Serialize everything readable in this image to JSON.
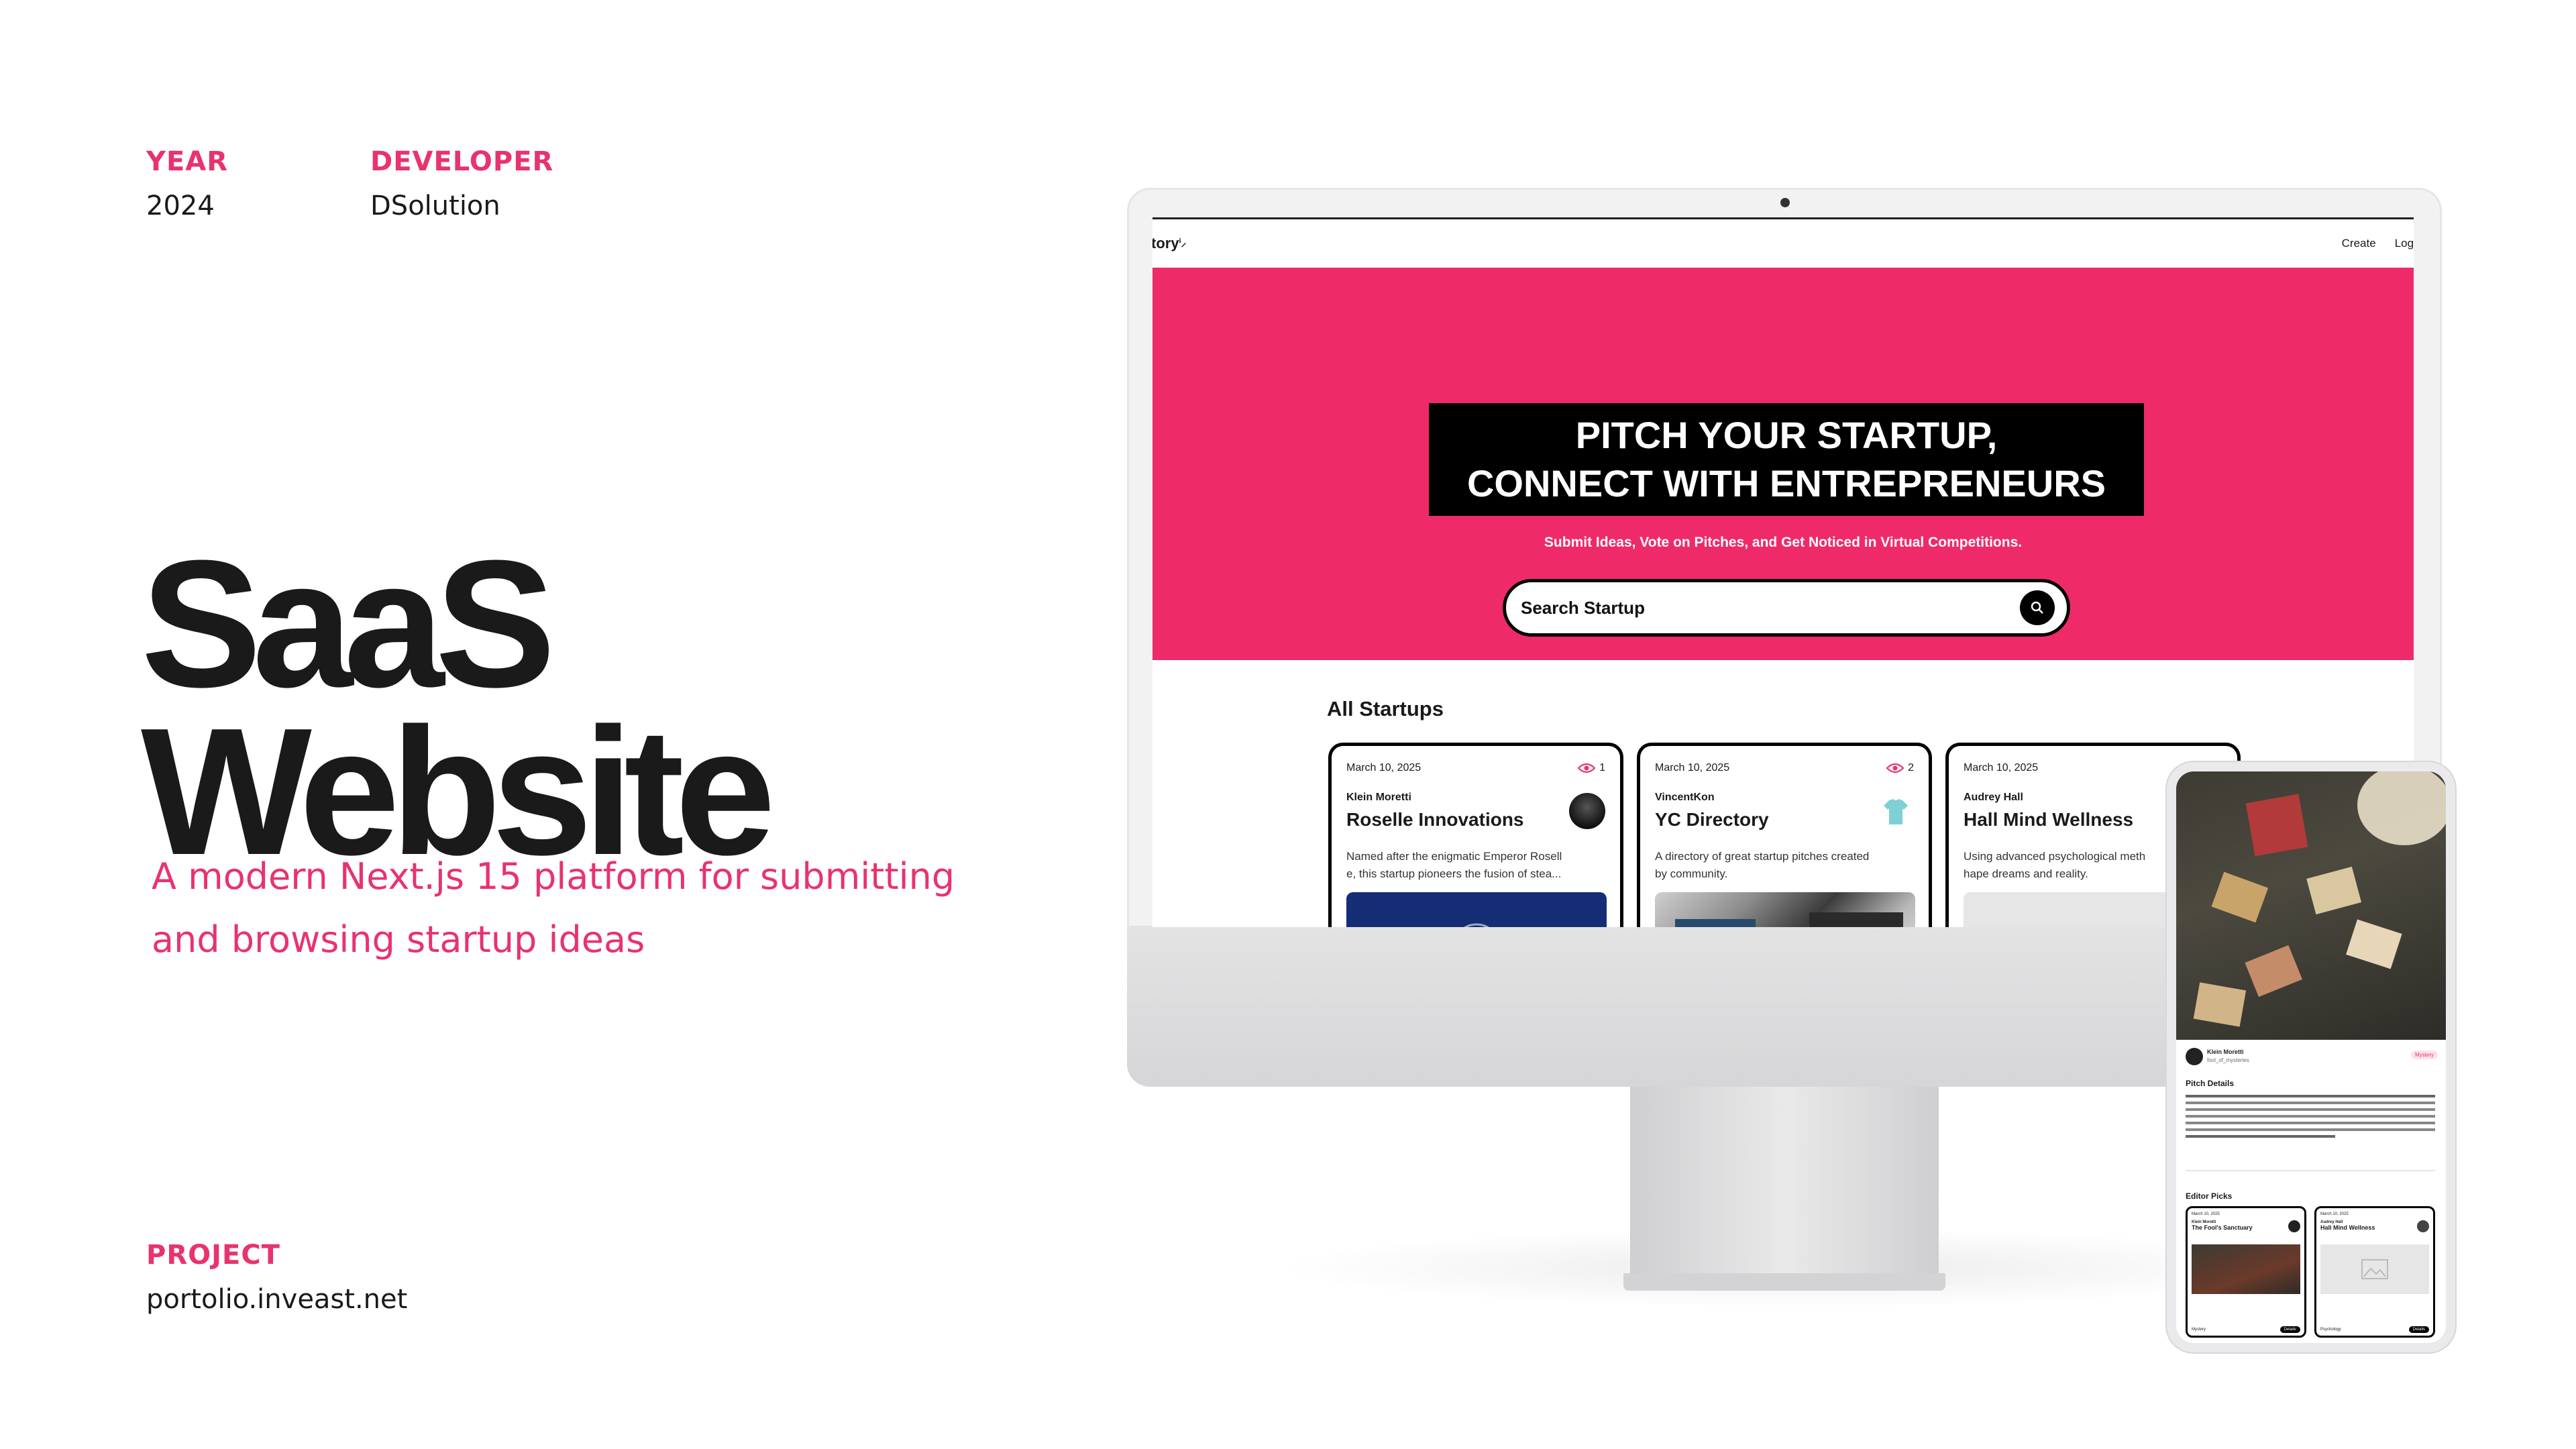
{
  "meta": {
    "year_label": "YEAR",
    "year_value": "2024",
    "developer_label": "DEVELOPER",
    "developer_value": "DSolution",
    "project_label": "PROJECT",
    "project_value": "portolio.inveast.net"
  },
  "hero_text": {
    "title_line1": "SaaS",
    "title_line2": "Website",
    "subtitle_line1": "A modern Next.js 15 platform for submitting",
    "subtitle_line2": "and browsing startup ideas"
  },
  "desktop": {
    "logo": "tory",
    "nav": {
      "create": "Create",
      "login": "Log O"
    },
    "heading_line1": "PITCH YOUR STARTUP,",
    "heading_line2": "CONNECT WITH ENTREPRENEURS",
    "tagline": "Submit Ideas, Vote on Pitches, and Get Noticed in Virtual Competitions.",
    "search_placeholder": "Search Startup",
    "section_title": "All Startups",
    "cards": [
      {
        "date": "March 10, 2025",
        "views": "1",
        "author": "Klein Moretti",
        "title": "Roselle Innovations",
        "desc_line1": "Named after the enigmatic Emperor Rosell",
        "desc_line2": "e, this startup pioneers the fusion of stea..."
      },
      {
        "date": "March 10, 2025",
        "views": "2",
        "author": "VincentKon",
        "title": "YC Directory",
        "desc_line1": "A directory of great startup pitches created",
        "desc_line2": "by community."
      },
      {
        "date": "March 10, 2025",
        "views": "",
        "author": "Audrey Hall",
        "title": "Hall Mind Wellness",
        "desc_line1": "Using advanced psychological meth",
        "desc_line2": "hape dreams and reality."
      }
    ]
  },
  "phone": {
    "author": "Klein Moretti",
    "handle": "fool_of_mysteries",
    "tag": "Mystery",
    "section": "Pitch Details",
    "picks_title": "Editor Picks",
    "pick1": {
      "date": "March 10, 2025",
      "author": "Klein Moretti",
      "title": "The Fool's Sanctuary",
      "category": "Mystery",
      "button": "Details"
    },
    "pick2": {
      "date": "March 10, 2025",
      "author": "Audrey Hall",
      "title": "Hall Mind Wellness",
      "category": "Psychology",
      "button": "Details"
    }
  },
  "colors": {
    "accent": "#e8336d",
    "hero_bg": "#ef2a68",
    "text": "#1a1a1a"
  }
}
